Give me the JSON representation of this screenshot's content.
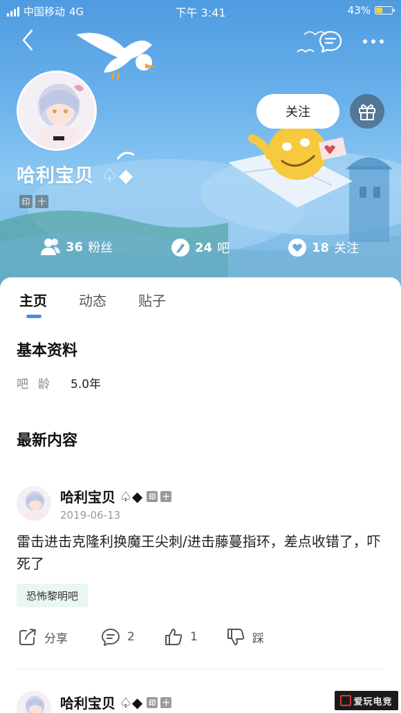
{
  "status_bar": {
    "carrier": "中国移动",
    "network": "4G",
    "time": "下午 3:41",
    "battery": "43%",
    "battery_level": 0.43
  },
  "nav": {
    "back_icon": "chevron-left-icon",
    "message_icon": "chat-bubble-icon",
    "more_icon": "more-dots-icon"
  },
  "profile": {
    "username": "哈利宝贝",
    "name_suffix": "♤◆",
    "badges": [
      "印",
      "十"
    ],
    "follow_label": "关注",
    "gift_icon": "gift-icon"
  },
  "stats": [
    {
      "icon": "fans-icon",
      "value": "36",
      "label": "粉丝"
    },
    {
      "icon": "bar-icon",
      "value": "24",
      "label": "吧"
    },
    {
      "icon": "heart-icon",
      "value": "18",
      "label": "关注"
    }
  ],
  "tabs": [
    {
      "label": "主页",
      "active": true
    },
    {
      "label": "动态",
      "active": false
    },
    {
      "label": "贴子",
      "active": false
    }
  ],
  "basic_info": {
    "title": "基本资料",
    "age_label": "吧龄",
    "age_value": "5.0年"
  },
  "latest": {
    "title": "最新内容"
  },
  "posts": [
    {
      "author": "哈利宝贝",
      "author_suffix": "♤◆",
      "badges": [
        "印",
        "十"
      ],
      "date": "2019-06-13",
      "text": "雷击进击克隆利换魔王尖刺/进击藤蔓指环，差点收错了，吓死了",
      "forum": "恐怖黎明吧",
      "share_label": "分享",
      "comment_count": "2",
      "like_count": "1",
      "dislike_label": "踩"
    },
    {
      "author": "哈利宝贝",
      "author_suffix": "♤◆",
      "badges": [
        "印",
        "十"
      ]
    }
  ],
  "watermark": {
    "text": "爱玩电竞"
  },
  "colors": {
    "accent": "#3f8ff0",
    "banner_top": "#4f9be0",
    "tag_bg": "#e9f6f3"
  }
}
